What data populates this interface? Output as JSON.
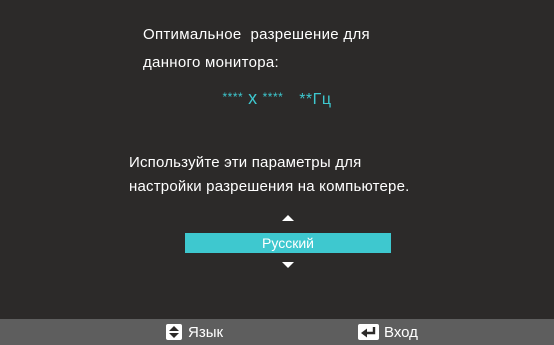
{
  "message": {
    "line1": "Оптимальное  разрешение для",
    "line2": "данного монитора:"
  },
  "resolution": {
    "width": "****",
    "separator": "x",
    "height": "****",
    "refresh": "**Гц"
  },
  "hint": {
    "line1": "Используйте эти параметры для",
    "line2": "настройки разрешения на компьютере."
  },
  "language_selector": {
    "selected": "Русский"
  },
  "bottom_bar": {
    "language_label": "Язык",
    "enter_label": "Вход",
    "language_icon": "up-down-arrows-icon",
    "enter_icon": "enter-return-icon"
  },
  "colors": {
    "background": "#2c2a29",
    "accent": "#3ec8cf",
    "bottom_bar": "#5e5e5e"
  }
}
